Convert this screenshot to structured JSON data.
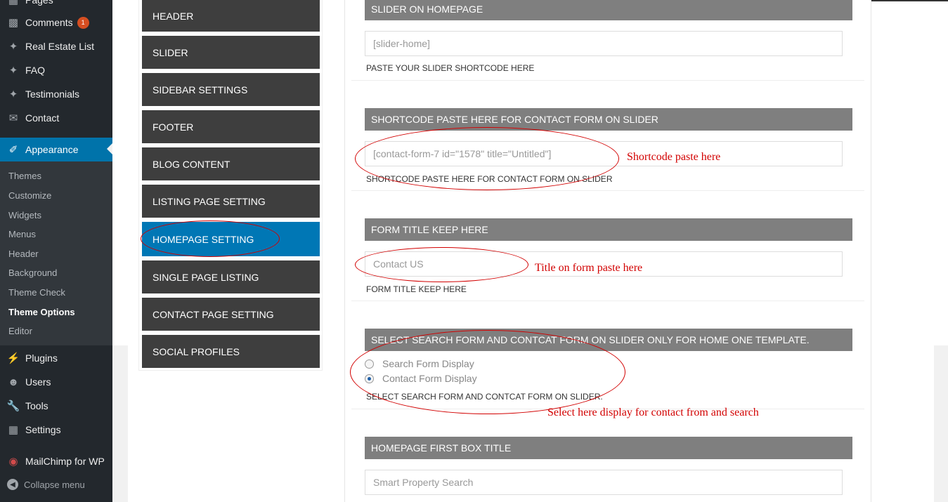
{
  "sidebar": {
    "top_items": [
      {
        "label": "Pages",
        "icon": "pages-icon"
      },
      {
        "label": "Comments",
        "icon": "comment-icon",
        "badge": "1"
      },
      {
        "label": "Real Estate List",
        "icon": "pin-icon"
      },
      {
        "label": "FAQ",
        "icon": "pin-icon"
      },
      {
        "label": "Testimonials",
        "icon": "pin-icon"
      },
      {
        "label": "Contact",
        "icon": "mail-icon"
      }
    ],
    "current": {
      "label": "Appearance",
      "icon": "paintbrush-icon"
    },
    "submenu": [
      "Themes",
      "Customize",
      "Widgets",
      "Menus",
      "Header",
      "Background",
      "Theme Check",
      "Theme Options",
      "Editor"
    ],
    "active_submenu": "Theme Options",
    "bottom_items": [
      {
        "label": "Plugins",
        "icon": "plugin-icon"
      },
      {
        "label": "Users",
        "icon": "user-icon"
      },
      {
        "label": "Tools",
        "icon": "wrench-icon"
      },
      {
        "label": "Settings",
        "icon": "settings-icon"
      },
      {
        "label": "MailChimp for WP",
        "icon": "mailchimp-icon"
      }
    ],
    "collapse_label": "Collapse menu"
  },
  "tabs": [
    "HEADER",
    "SLIDER",
    "SIDEBAR SETTINGS",
    "FOOTER",
    "BLOG CONTENT",
    "LISTING PAGE SETTING",
    "HOMEPAGE SETTING",
    "SINGLE PAGE LISTING",
    "CONTACT PAGE SETTING",
    "SOCIAL PROFILES"
  ],
  "active_tab": "HOMEPAGE SETTING",
  "sections": {
    "slider": {
      "title": "SLIDER ON HOMEPAGE",
      "value": "[slider-home]",
      "desc": "PASTE YOUR SLIDER SHORTCODE HERE"
    },
    "contact_form": {
      "title": "SHORTCODE PASTE HERE FOR CONTACT FORM ON SLIDER",
      "value": "[contact-form-7 id=\"1578\" title=\"Untitled\"]",
      "desc": "SHORTCODE PASTE HERE FOR CONTACT FORM ON SLIDER"
    },
    "form_title": {
      "title": "FORM TITLE KEEP HERE",
      "value": "Contact US",
      "desc": "FORM TITLE KEEP HERE"
    },
    "select_form": {
      "title": "SELECT SEARCH FORM AND CONTCAT FORM ON SLIDER ONLY FOR HOME ONE TEMPLATE.",
      "options": [
        {
          "label": "Search Form Display",
          "checked": false
        },
        {
          "label": "Contact Form Display",
          "checked": true
        }
      ],
      "desc": "SELECT SEARCH FORM AND CONTCAT FORM ON SLIDER."
    },
    "first_box": {
      "title": "HOMEPAGE FIRST BOX TITLE",
      "value": "Smart Property Search"
    }
  },
  "annotations": {
    "shortcode": "Shortcode paste here",
    "title": "Title on form paste here",
    "select": "Select here display for contact from and search"
  },
  "colors": {
    "sidebar": "#23282d",
    "accent": "#0073aa",
    "tab_dark": "#3e3e3e",
    "tab_active": "#0077b5",
    "section_head": "#7f7f7f",
    "annotation": "#d20000"
  }
}
